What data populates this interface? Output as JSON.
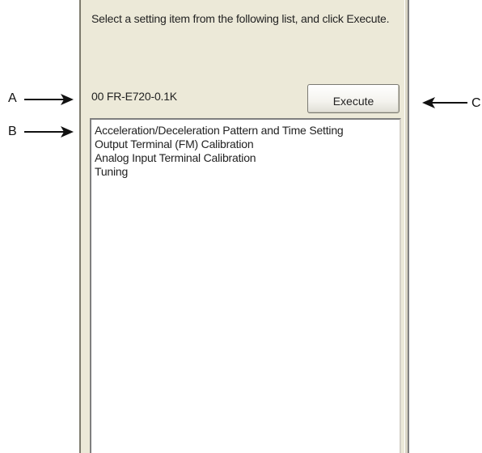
{
  "panel": {
    "instruction": "Select a setting item from the following list, and click Execute.",
    "model_name": "00 FR-E720-0.1K",
    "execute_label": "Execute",
    "items": [
      {
        "label": "Acceleration/Deceleration Pattern and Time Setting"
      },
      {
        "label": "Output Terminal (FM) Calibration"
      },
      {
        "label": "Analog Input Terminal Calibration"
      },
      {
        "label": "Tuning"
      }
    ]
  },
  "callouts": {
    "a": "A",
    "b": "B",
    "c": "C"
  }
}
